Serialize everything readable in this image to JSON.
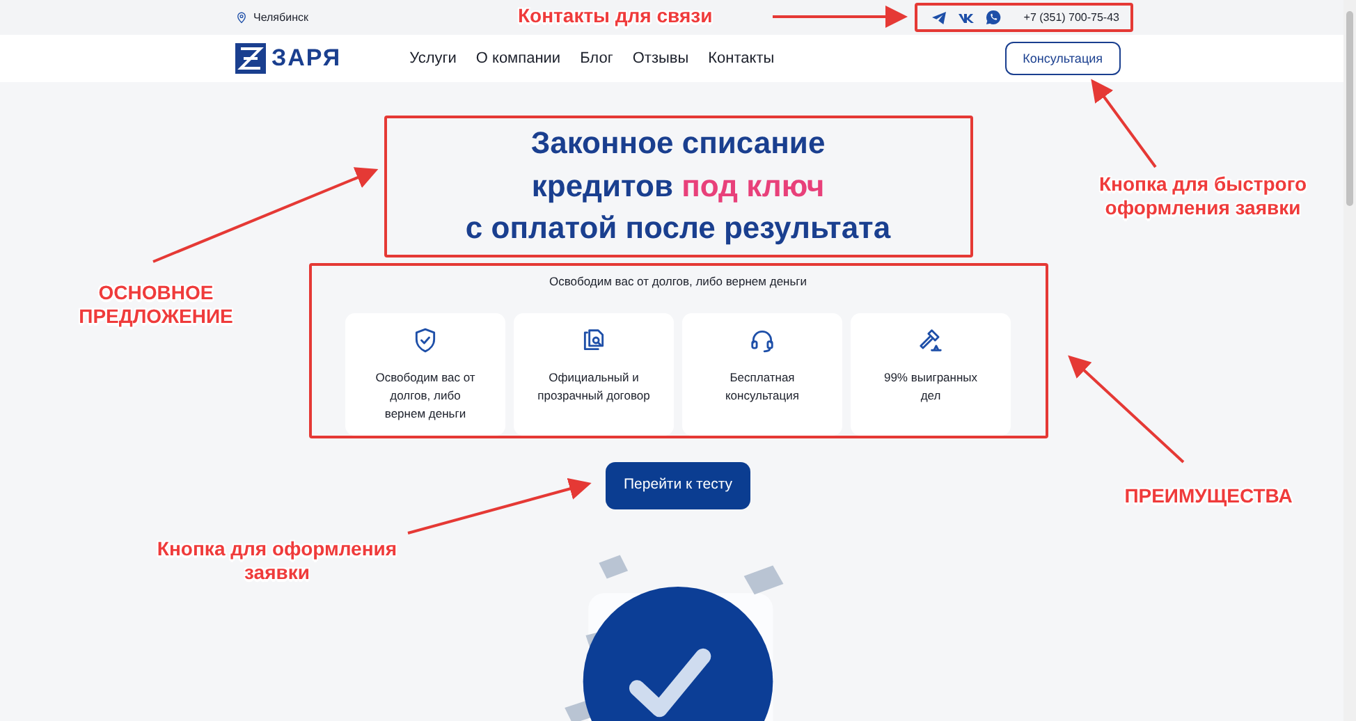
{
  "topbar": {
    "city": "Челябинск",
    "phone": "+7 (351) 700-75-43"
  },
  "navbar": {
    "logo": "ЗАРЯ",
    "links": [
      "Услуги",
      "О компании",
      "Блог",
      "Отзывы",
      "Контакты"
    ],
    "button": "Консультация"
  },
  "hero": {
    "title_lines": [
      "Законное списание",
      "кредитов **под ключ**",
      "с оплатой после результата"
    ],
    "subtitle": "Освободим вас от долгов, либо вернем деньги",
    "features": [
      {
        "kind": "shield",
        "text": "Освободим вас от долгов, либо вернем деньги"
      },
      {
        "kind": "document",
        "text": "Официальный и прозрачный договор"
      },
      {
        "kind": "headset",
        "text": "Бесплатная консультация"
      },
      {
        "kind": "gavel",
        "text": "99% выигранных дел"
      }
    ],
    "button": "Перейти к тесту"
  },
  "callouts": [
    "Контакты для связи",
    "ОСНОВНОЕ ПРЕДЛОЖЕНИЕ",
    "Кнопка для быстрого оформления заявки",
    "ПРЕИМУЩЕСТВА",
    "Кнопка для оформления заявки"
  ]
}
